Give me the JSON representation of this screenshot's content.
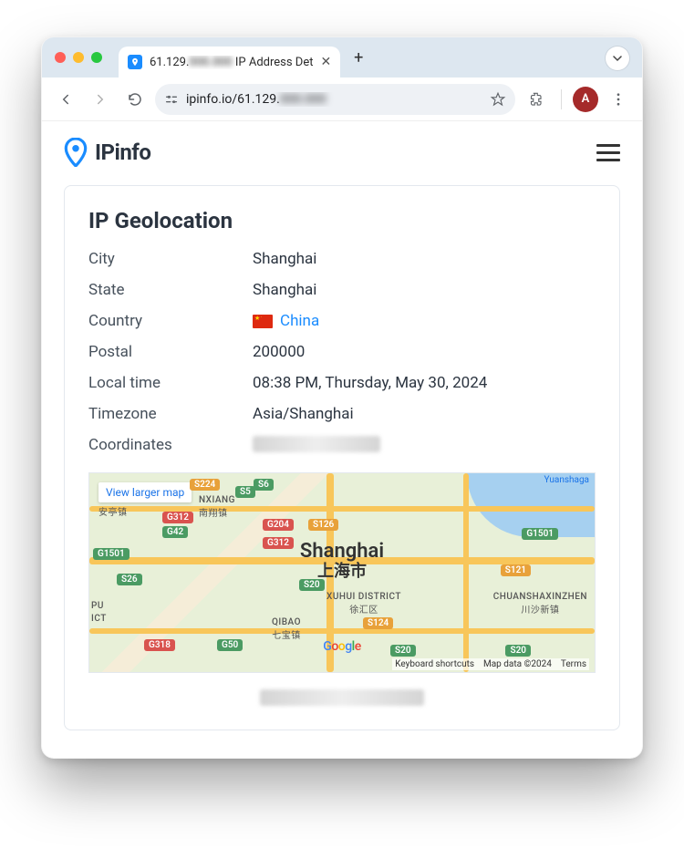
{
  "browser": {
    "tab_title_prefix": "61.129.",
    "tab_title_suffix": " IP Address Det",
    "url_prefix": "ipinfo.io/61.129.",
    "avatar_letter": "A"
  },
  "site": {
    "logo_text": "IPinfo"
  },
  "card": {
    "heading": "IP Geolocation",
    "labels": {
      "city": "City",
      "state": "State",
      "country": "Country",
      "postal": "Postal",
      "localtime": "Local time",
      "timezone": "Timezone",
      "coordinates": "Coordinates"
    },
    "values": {
      "city": "Shanghai",
      "state": "Shanghai",
      "country": "China",
      "postal": "200000",
      "localtime": "08:38 PM, Thursday, May 30, 2024",
      "timezone": "Asia/Shanghai"
    }
  },
  "map": {
    "view_larger": "View larger map",
    "city_en": "Shanghai",
    "city_cn": "上海市",
    "districts": {
      "xuhui": "XUHUI DISTRICT",
      "xuhui_cn": "徐汇区",
      "qibao": "QIBAO",
      "qibao_cn": "七宝镇",
      "chuansha": "CHUANSHAXINZHEN",
      "chuansha_cn": "川沙新镇",
      "pu": "PU",
      "ict": "ICT",
      "nanxiang": "NXIANG",
      "nanxiang_cn": "南翔镇",
      "anting_cn": "安亭镇",
      "yuanshaga": "Yuanshaga"
    },
    "shields": {
      "s224": "S224",
      "s6": "S6",
      "s5": "S5",
      "g42": "G42",
      "g312_1": "G312",
      "g204": "G204",
      "s126": "S126",
      "g312_2": "G312",
      "g1501_l": "G1501",
      "g1501_r": "G1501",
      "s26": "S26",
      "s20_l": "S20",
      "s20_c": "S20",
      "s20_r": "S20",
      "s121": "S121",
      "s124": "S124",
      "g318": "G318",
      "g50": "G50"
    },
    "footer": {
      "kb": "Keyboard shortcuts",
      "data": "Map data ©2024",
      "terms": "Terms"
    },
    "google": "Google"
  }
}
